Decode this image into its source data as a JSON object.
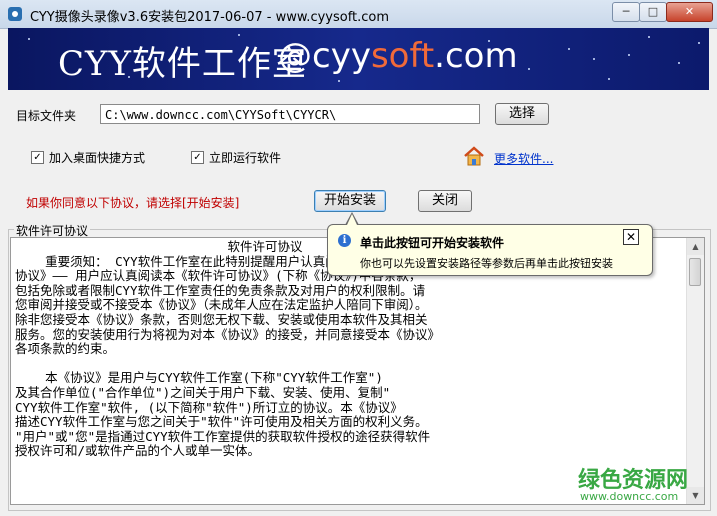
{
  "window": {
    "title": "CYY摄像头录像v3.6安装包2017-06-07 - www.cyysoft.com",
    "btn_min": "─",
    "btn_max": "□",
    "btn_close": "✕"
  },
  "banner": {
    "text": "CYY软件工作室",
    "brand_prefix": "@cyy",
    "brand_em": "soft",
    "brand_suffix": ".com"
  },
  "form": {
    "target_label": "目标文件夹",
    "target_value": "C:\\www.downcc.com\\CYYSoft\\CYYCR\\",
    "browse_label": "选择",
    "desktop_shortcut_label": "加入桌面快捷方式",
    "desktop_shortcut_checked": true,
    "run_now_label": "立即运行软件",
    "run_now_checked": true,
    "more_software_link": "更多软件...",
    "agree_notice": "如果你同意以下协议，请选择[开始安装]",
    "install_label": "开始安装",
    "close_label": "关闭"
  },
  "license": {
    "group_title": "软件许可协议",
    "heading": "软件许可协议",
    "lines": [
      "    重要须知： CYY软件工作室在此特别提醒用户认真阅读《软件许可",
      "协议》—— 用户应认真阅读本《软件许可协议》(下称《协议》)中各条款，",
      "包括免除或者限制CYY软件工作室责任的免责条款及对用户的权利限制。请",
      "您审阅并接受或不接受本《协议》（未成年人应在法定监护人陪同下审阅）。",
      "除非您接受本《协议》条款，否则您无权下载、安装或使用本软件及其相关",
      "服务。您的安装使用行为将视为对本《协议》的接受，并同意接受本《协议》",
      "各项条款的约束。",
      "",
      "    本《协议》是用户与CYY软件工作室(下称\"CYY软件工作室\")",
      "及其合作单位(\"合作单位\")之间关于用户下载、安装、使用、复制\"",
      "CYY软件工作室\"软件, (以下简称\"软件\")所订立的协议。本《协议》",
      "描述CYY软件工作室与您之间关于\"软件\"许可使用及相关方面的权利义务。",
      "\"用户\"或\"您\"是指通过CYY软件工作室提供的获取软件授权的途径获得软件",
      "授权许可和/或软件产品的个人或单一实体。"
    ]
  },
  "tooltip": {
    "title": "单击此按钮可开始安装软件",
    "body": "你也可以先设置安装路径等参数后再单击此按钮安装",
    "close": "✕",
    "info": "i"
  },
  "watermark": {
    "text": "绿色资源网",
    "url": "www.downcc.com"
  },
  "colors": {
    "link": "#0033cc",
    "notice": "#c00000",
    "tooltip_bg": "#ffffe6",
    "watermark": "#39a844"
  }
}
